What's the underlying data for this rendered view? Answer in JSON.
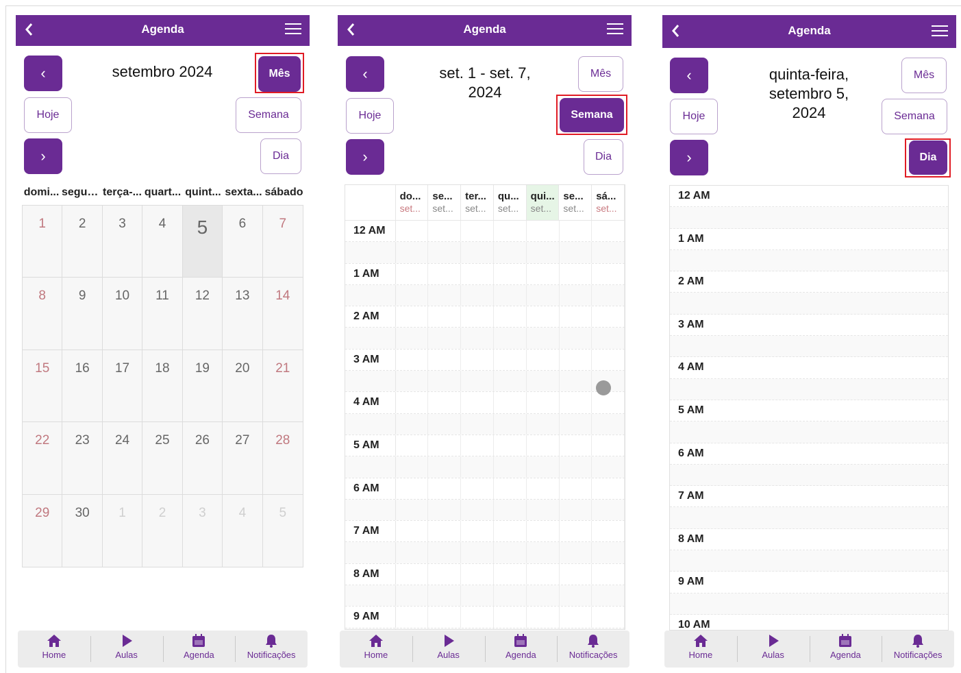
{
  "colors": {
    "primary": "#6a2b94",
    "highlight": "#e01b24",
    "weekend": "#c0787f",
    "today_header": "#e6f5e6"
  },
  "app": {
    "title": "Agenda",
    "back_icon": "chevron-left-icon",
    "menu_icon": "hamburger-menu-icon"
  },
  "buttons": {
    "month": "Mês",
    "today": "Hoje",
    "week": "Semana",
    "day": "Dia",
    "prev": "‹",
    "next": "›"
  },
  "month_view": {
    "period": "setembro 2024",
    "weekdays": [
      "domi...",
      "segun...",
      "terça-...",
      "quart...",
      "quint...",
      "sexta...",
      "sábado"
    ],
    "weeks": [
      [
        "1",
        "2",
        "3",
        "4",
        "5",
        "6",
        "7"
      ],
      [
        "8",
        "9",
        "10",
        "11",
        "12",
        "13",
        "14"
      ],
      [
        "15",
        "16",
        "17",
        "18",
        "19",
        "20",
        "21"
      ],
      [
        "22",
        "23",
        "24",
        "25",
        "26",
        "27",
        "28"
      ],
      [
        "29",
        "30",
        "1",
        "2",
        "3",
        "4",
        "5"
      ]
    ],
    "today": "5",
    "active_view": "Mês"
  },
  "week_view": {
    "period": "set. 1 - set. 7, 2024",
    "days": [
      {
        "name": "do...",
        "date": "set..."
      },
      {
        "name": "se...",
        "date": "set..."
      },
      {
        "name": "ter...",
        "date": "set..."
      },
      {
        "name": "qu...",
        "date": "set..."
      },
      {
        "name": "qui...",
        "date": "set..."
      },
      {
        "name": "se...",
        "date": "set..."
      },
      {
        "name": "sá...",
        "date": "set..."
      }
    ],
    "hours": [
      "12 AM",
      "1 AM",
      "2 AM",
      "3 AM",
      "4 AM",
      "5 AM",
      "6 AM",
      "7 AM",
      "8 AM",
      "9 AM"
    ],
    "active_view": "Semana"
  },
  "day_view": {
    "period": "quinta-feira, setembro 5, 2024",
    "hours": [
      "12 AM",
      "1 AM",
      "2 AM",
      "3 AM",
      "4 AM",
      "5 AM",
      "6 AM",
      "7 AM",
      "8 AM",
      "9 AM",
      "10 AM"
    ],
    "active_view": "Dia"
  },
  "bottom_nav": [
    {
      "label": "Home",
      "icon": "home-icon"
    },
    {
      "label": "Aulas",
      "icon": "play-icon"
    },
    {
      "label": "Agenda",
      "icon": "calendar-icon"
    },
    {
      "label": "Notificações",
      "icon": "bell-icon"
    }
  ]
}
